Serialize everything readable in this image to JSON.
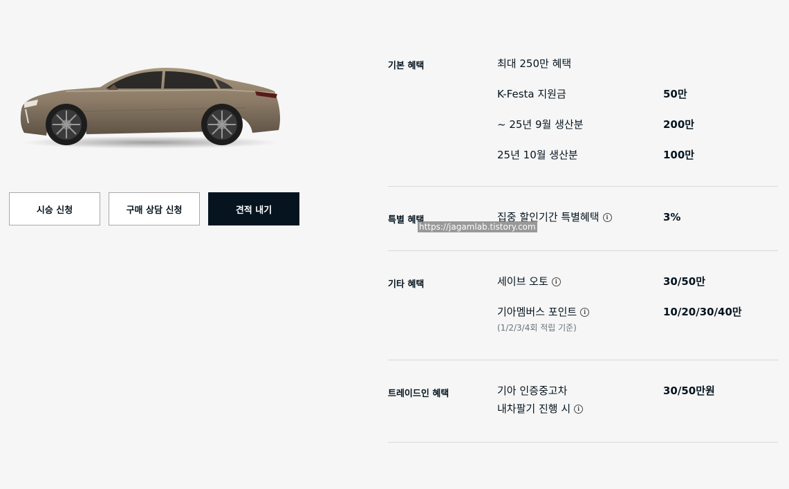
{
  "car_image": {
    "color": "#8a7a66"
  },
  "buttons": {
    "test_drive": "시승 신청",
    "consult": "구매 상담 신청",
    "quote": "견적 내기"
  },
  "benefits": {
    "basic": {
      "title": "기본 혜택",
      "rows": [
        {
          "label": "최대 250만 혜택",
          "value": ""
        },
        {
          "label": "K-Festa 지원금",
          "value": "50만"
        },
        {
          "label": "~ 25년 9월 생산분",
          "value": "200만"
        },
        {
          "label": "25년 10월 생산분",
          "value": "100만"
        }
      ]
    },
    "special": {
      "title": "특별 혜택",
      "rows": [
        {
          "label": "집중 할인기간 특별혜택",
          "value": "3%"
        }
      ]
    },
    "other": {
      "title": "기타 혜택",
      "rows": [
        {
          "label": "세이브 오토",
          "value": "30/50만"
        },
        {
          "label": "기아멤버스 포인트",
          "sub": "(1/2/3/4회 적립 기준)",
          "value": "10/20/30/40만"
        }
      ]
    },
    "tradein": {
      "title": "트레이드인 혜택",
      "rows": [
        {
          "label_line1": "기아 인증중고차",
          "label_line2": "내차팔기 진행 시",
          "value": "30/50만원"
        }
      ]
    }
  },
  "info_glyph": "i",
  "watermark": "https://jagamlab.tistory.com"
}
